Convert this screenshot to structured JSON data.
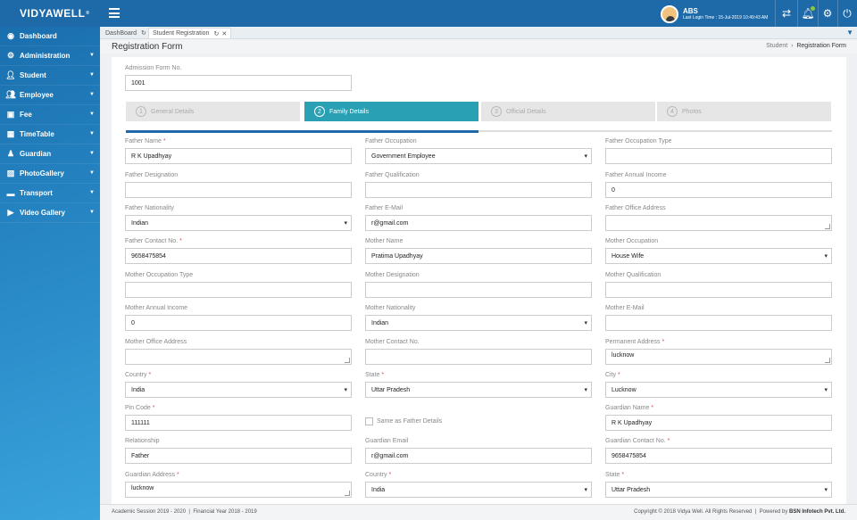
{
  "app": {
    "logo": "VIDYAWELL",
    "logo_mark": "®"
  },
  "user": {
    "name": "ABS",
    "last_login": "Last Login Time : 15-Jul-2019 10:49:43 AM"
  },
  "sidebar": {
    "items": [
      {
        "label": "Dashboard",
        "icon": "dashboard-icon"
      },
      {
        "label": "Administration",
        "icon": "gear-icon"
      },
      {
        "label": "Student",
        "icon": "student-icon"
      },
      {
        "label": "Employee",
        "icon": "employee-icon"
      },
      {
        "label": "Fee",
        "icon": "money-icon"
      },
      {
        "label": "TimeTable",
        "icon": "calendar-icon"
      },
      {
        "label": "Guardian",
        "icon": "guardian-icon"
      },
      {
        "label": "PhotoGallery",
        "icon": "photo-icon"
      },
      {
        "label": "Transport",
        "icon": "truck-icon"
      },
      {
        "label": "Video Gallery",
        "icon": "video-icon"
      }
    ]
  },
  "tabs": [
    {
      "label": "DashBoard"
    },
    {
      "label": "Student Registration"
    }
  ],
  "page": {
    "title": "Registration Form",
    "breadcrumb_parent": "Student",
    "breadcrumb_sep": "›",
    "breadcrumb_current": "Registration Form"
  },
  "form": {
    "admission_label": "Admission Form No.",
    "admission_value": "1001",
    "steps": [
      {
        "num": "1",
        "label": "General Details"
      },
      {
        "num": "2",
        "label": "Family Details"
      },
      {
        "num": "3",
        "label": "Official Details"
      },
      {
        "num": "4",
        "label": "Photos"
      }
    ],
    "fields": {
      "father_name": {
        "label": "Father Name",
        "value": "R K Upadhyay"
      },
      "father_occupation": {
        "label": "Father Occupation",
        "value": "Government Employee"
      },
      "father_occupation_type": {
        "label": "Father Occupation Type",
        "value": ""
      },
      "father_designation": {
        "label": "Father Designation",
        "value": ""
      },
      "father_qualification": {
        "label": "Father Qualification",
        "value": ""
      },
      "father_annual_income": {
        "label": "Father Annual Income",
        "value": "0"
      },
      "father_nationality": {
        "label": "Father Nationality",
        "value": "Indian"
      },
      "father_email": {
        "label": "Father E-Mail",
        "value": "r@gmail.com"
      },
      "father_office_address": {
        "label": "Father Office Address",
        "value": ""
      },
      "father_contact": {
        "label": "Father Contact No.",
        "value": "9658475854"
      },
      "mother_name": {
        "label": "Mother Name",
        "value": "Pratima Upadhyay"
      },
      "mother_occupation": {
        "label": "Mother Occupation",
        "value": "House Wife"
      },
      "mother_occupation_type": {
        "label": "Mother Occupation Type",
        "value": ""
      },
      "mother_designation": {
        "label": "Mother Designation",
        "value": ""
      },
      "mother_qualification": {
        "label": "Mother Qualification",
        "value": ""
      },
      "mother_annual_income": {
        "label": "Mother Annual Income",
        "value": "0"
      },
      "mother_nationality": {
        "label": "Mother Nationality",
        "value": "Indian"
      },
      "mother_email": {
        "label": "Mother E-Mail",
        "value": ""
      },
      "mother_office_address": {
        "label": "Mother Office Address",
        "value": ""
      },
      "mother_contact": {
        "label": "Mother Contact No.",
        "value": ""
      },
      "permanent_address": {
        "label": "Permanent Address",
        "value": "lucknow"
      },
      "country": {
        "label": "Country",
        "value": "India"
      },
      "state": {
        "label": "State",
        "value": "Uttar Pradesh"
      },
      "city": {
        "label": "City",
        "value": "Lucknow"
      },
      "pin_code": {
        "label": "Pin Code",
        "value": "111111"
      },
      "same_as_father": {
        "label": "Same as Father Details"
      },
      "guardian_name": {
        "label": "Guardian Name",
        "value": "R K Upadhyay"
      },
      "relationship": {
        "label": "Relationship",
        "value": "Father"
      },
      "guardian_email": {
        "label": "Guardian Email",
        "value": "r@gmail.com"
      },
      "guardian_contact": {
        "label": "Guardian Contact No.",
        "value": "9658475854"
      },
      "guardian_address": {
        "label": "Guardian Address",
        "value": "lucknow"
      },
      "g_country": {
        "label": "Country",
        "value": "India"
      },
      "g_state": {
        "label": "State",
        "value": "Uttar Pradesh"
      }
    },
    "required_mark": "*"
  },
  "footer": {
    "session": "Academic Session 2019 - 2020",
    "sep": "|",
    "financial": "Financial Year 2018 - 2019",
    "copyright": "Copyright © 2018 Vidya Well. All Rights Reserved",
    "powered_prefix": "Powered by",
    "powered_by": "BSN Infotech Pvt. Ltd."
  },
  "colors": {
    "primary": "#1e6aa8",
    "active_step": "#2aa0b4",
    "required": "#d9534f"
  }
}
